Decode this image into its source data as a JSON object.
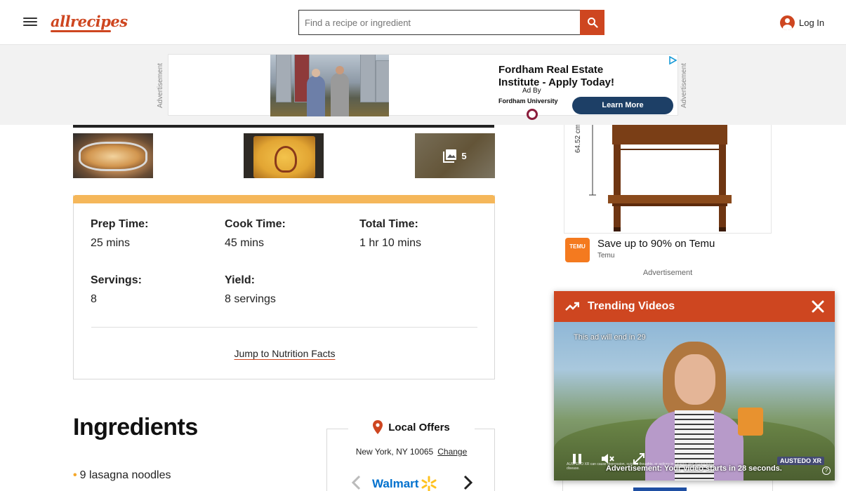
{
  "header": {
    "logo": "allrecipes",
    "search_placeholder": "Find a recipe or ingredient",
    "login_label": "Log In"
  },
  "top_ad": {
    "side_label": "Advertisement",
    "headline": "Fordham Real Estate Institute - Apply Today!",
    "ad_by": "Ad By",
    "sponsor": "Fordham University",
    "cta": "Learn More"
  },
  "gallery": {
    "photo_count": "5"
  },
  "details": {
    "prep_label": "Prep Time:",
    "prep_value": "25 mins",
    "cook_label": "Cook Time:",
    "cook_value": "45 mins",
    "total_label": "Total Time:",
    "total_value": "1 hr 10 mins",
    "servings_label": "Servings:",
    "servings_value": "8",
    "yield_label": "Yield:",
    "yield_value": "8 servings",
    "nutrition_link": "Jump to Nutrition Facts"
  },
  "ingredients": {
    "title": "Ingredients",
    "items": [
      "9 lasagna noodles"
    ]
  },
  "local_offers": {
    "title": "Local Offers",
    "location": "New York, NY 10065",
    "change_label": "Change",
    "retailer": "Walmart"
  },
  "side_ad": {
    "dimension_text": "64.52 cm",
    "temu_logo": "TEMU",
    "temu_headline": "Save up to 90% on Temu",
    "temu_brand": "Temu",
    "label": "Advertisement"
  },
  "trending": {
    "title": "Trending Videos",
    "countdown": "This ad will end in 29",
    "ad_notice": "Advertisement: Your video starts in 28 seconds.",
    "fineprint": "AUSTEDO XR can cause depression, suicidal thoughts, or actions in patients with Huntington's disease.",
    "brand": "AUSTEDO XR"
  },
  "colors": {
    "brand": "#ce4620",
    "accent": "#f5b75a",
    "walmart_blue": "#0071ce"
  }
}
